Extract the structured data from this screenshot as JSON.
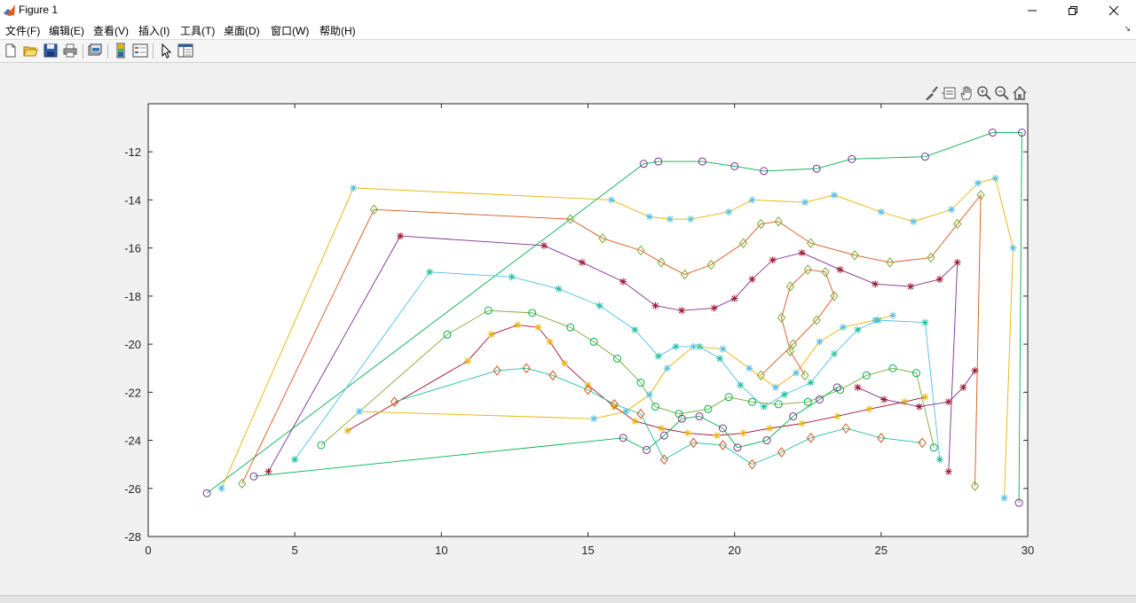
{
  "window": {
    "title": "Figure 1"
  },
  "menu": [
    "文件(F)",
    "编辑(E)",
    "查看(V)",
    "插入(I)",
    "工具(T)",
    "桌面(D)",
    "窗口(W)",
    "帮助(H)"
  ],
  "toolbar": [
    "new-figure-icon",
    "open-file-icon",
    "save-icon",
    "print-icon",
    "link-plot-icon",
    "colorbar-icon",
    "legend-icon",
    "pointer-icon",
    "property-inspector-icon"
  ],
  "axes_toolbar": [
    "brush-icon",
    "data-tips-icon",
    "pan-icon",
    "zoom-in-icon",
    "zoom-out-icon",
    "home-icon"
  ],
  "chart_data": {
    "type": "line",
    "title": "",
    "xlabel": "",
    "ylabel": "",
    "xlim": [
      0,
      30
    ],
    "ylim": [
      -28,
      -10
    ],
    "xticks": [
      0,
      5,
      10,
      15,
      20,
      25,
      30
    ],
    "yticks": [
      -28,
      -26,
      -24,
      -22,
      -20,
      -18,
      -16,
      -14,
      -12
    ],
    "grid": false,
    "colors": [
      "#00b050",
      "#e6b400",
      "#d95319",
      "#7e2f8e",
      "#4dbeee",
      "#77ac30",
      "#a2142f",
      "#1fbfa0"
    ],
    "markers": [
      "o",
      "*",
      "diamond",
      "*",
      "*",
      "o",
      "*",
      "diamond"
    ],
    "series": [
      {
        "x": [
          2.0,
          16.9,
          17.4,
          18.9,
          20.0,
          21.0,
          22.8,
          24.0,
          26.5,
          28.8,
          29.8,
          29.7
        ],
        "y": [
          -26.2,
          -12.5,
          -12.4,
          -12.4,
          -12.6,
          -12.8,
          -12.7,
          -12.3,
          -12.2,
          -11.2,
          -11.2,
          -26.6
        ]
      },
      {
        "x": [
          2.5,
          7.0,
          15.8,
          17.1,
          17.8,
          18.5,
          19.8,
          20.6,
          22.4,
          23.4,
          25.0,
          26.1,
          27.4,
          28.3,
          28.9,
          29.5,
          29.2
        ],
        "y": [
          -26.0,
          -13.5,
          -14.0,
          -14.7,
          -14.8,
          -14.8,
          -14.5,
          -14.0,
          -14.1,
          -13.8,
          -14.5,
          -14.9,
          -14.4,
          -13.3,
          -13.1,
          -16.0,
          -26.4
        ]
      },
      {
        "x": [
          3.2,
          7.7,
          14.4,
          15.5,
          16.8,
          17.5,
          18.3,
          19.2,
          20.3,
          20.9,
          21.5,
          22.6,
          24.1,
          25.3,
          26.7,
          27.6,
          28.4,
          28.2
        ],
        "y": [
          -25.8,
          -14.4,
          -14.8,
          -15.6,
          -16.1,
          -16.6,
          -17.1,
          -16.7,
          -15.8,
          -15.0,
          -14.9,
          -15.8,
          -16.3,
          -16.6,
          -16.4,
          -15.0,
          -13.8,
          -25.9
        ]
      },
      {
        "x": [
          4.1,
          8.6,
          13.5,
          14.8,
          16.2,
          17.3,
          18.2,
          19.3,
          20.0,
          20.6,
          21.3,
          22.3,
          23.6,
          24.8,
          26.0,
          27.0,
          27.6,
          27.3
        ],
        "y": [
          -25.3,
          -15.5,
          -15.9,
          -16.6,
          -17.4,
          -18.4,
          -18.6,
          -18.5,
          -18.1,
          -17.3,
          -16.5,
          -16.2,
          -16.9,
          -17.5,
          -17.6,
          -17.3,
          -16.6,
          -25.3
        ]
      },
      {
        "x": [
          5.0,
          9.6,
          12.4,
          14.0,
          15.4,
          16.6,
          17.4,
          18.0,
          18.8,
          19.5,
          20.2,
          21.0,
          21.7,
          22.6,
          23.4,
          24.2,
          24.9,
          26.5,
          27.0
        ],
        "y": [
          -24.8,
          -17.0,
          -17.2,
          -17.7,
          -18.4,
          -19.4,
          -20.5,
          -20.1,
          -20.1,
          -20.6,
          -21.7,
          -22.6,
          -22.1,
          -21.6,
          -20.4,
          -19.4,
          -19.0,
          -19.1,
          -24.8
        ]
      },
      {
        "x": [
          5.9,
          10.2,
          11.6,
          13.1,
          14.4,
          15.2,
          16.0,
          16.8,
          17.3,
          18.1,
          19.1,
          19.8,
          20.6,
          21.5,
          22.5,
          23.6,
          24.5,
          25.4,
          26.2,
          26.8
        ],
        "y": [
          -24.2,
          -19.6,
          -18.6,
          -18.7,
          -19.3,
          -19.9,
          -20.6,
          -21.6,
          -22.6,
          -22.9,
          -22.7,
          -22.2,
          -22.4,
          -22.5,
          -22.4,
          -21.9,
          -21.3,
          -21.0,
          -21.2,
          -24.3
        ]
      },
      {
        "x": [
          6.8,
          10.9,
          11.7,
          12.6,
          13.3,
          13.7,
          14.2,
          15.0,
          15.9,
          16.6,
          17.5,
          18.4,
          19.4,
          20.3,
          21.2,
          22.3,
          23.5,
          24.6,
          25.8,
          26.5
        ],
        "y": [
          -23.6,
          -20.7,
          -19.6,
          -19.2,
          -19.3,
          -19.9,
          -20.8,
          -21.7,
          -22.6,
          -23.2,
          -23.5,
          -23.7,
          -23.8,
          -23.7,
          -23.5,
          -23.3,
          -23.0,
          -22.7,
          -22.4,
          -22.2
        ]
      },
      {
        "x": [
          8.4,
          11.9,
          12.9,
          13.8,
          15.0,
          15.9,
          16.8,
          17.6,
          18.6,
          19.6,
          20.6,
          21.6,
          22.6,
          23.8,
          25.0,
          26.4
        ],
        "y": [
          -22.4,
          -21.1,
          -21.0,
          -21.3,
          -21.9,
          -22.5,
          -22.9,
          -24.8,
          -24.1,
          -24.2,
          -25.0,
          -24.5,
          -23.9,
          -23.5,
          -23.9,
          -24.1
        ]
      },
      {
        "x": [
          3.6,
          16.2,
          17.0,
          17.6,
          18.2,
          18.8,
          19.6,
          20.1,
          21.1,
          22.0,
          22.9,
          23.5
        ],
        "y": [
          -25.5,
          -23.9,
          -24.4,
          -23.8,
          -23.1,
          -23.0,
          -23.5,
          -24.3,
          -24.0,
          -23.0,
          -22.3,
          -21.8
        ]
      },
      {
        "x": [
          7.2,
          15.2,
          16.3,
          17.1,
          17.7,
          18.6,
          19.6,
          20.5,
          21.4,
          22.1,
          22.9,
          23.7,
          24.8,
          25.4
        ],
        "y": [
          -22.8,
          -23.1,
          -22.8,
          -22.1,
          -21.0,
          -20.1,
          -20.2,
          -21.0,
          -21.8,
          -21.2,
          -19.9,
          -19.3,
          -19.0,
          -18.8
        ]
      },
      {
        "x": [
          20.9,
          22.0,
          22.8,
          23.4,
          23.1,
          22.5,
          21.9,
          21.6,
          21.9,
          22.4
        ],
        "y": [
          -21.3,
          -20.0,
          -19.0,
          -18.0,
          -17.0,
          -16.9,
          -17.6,
          -18.9,
          -20.3,
          -21.3
        ]
      },
      {
        "x": [
          24.2,
          25.1,
          26.3,
          27.3,
          27.8,
          28.2
        ],
        "y": [
          -21.8,
          -22.3,
          -22.6,
          -22.4,
          -21.8,
          -21.1
        ]
      }
    ]
  }
}
